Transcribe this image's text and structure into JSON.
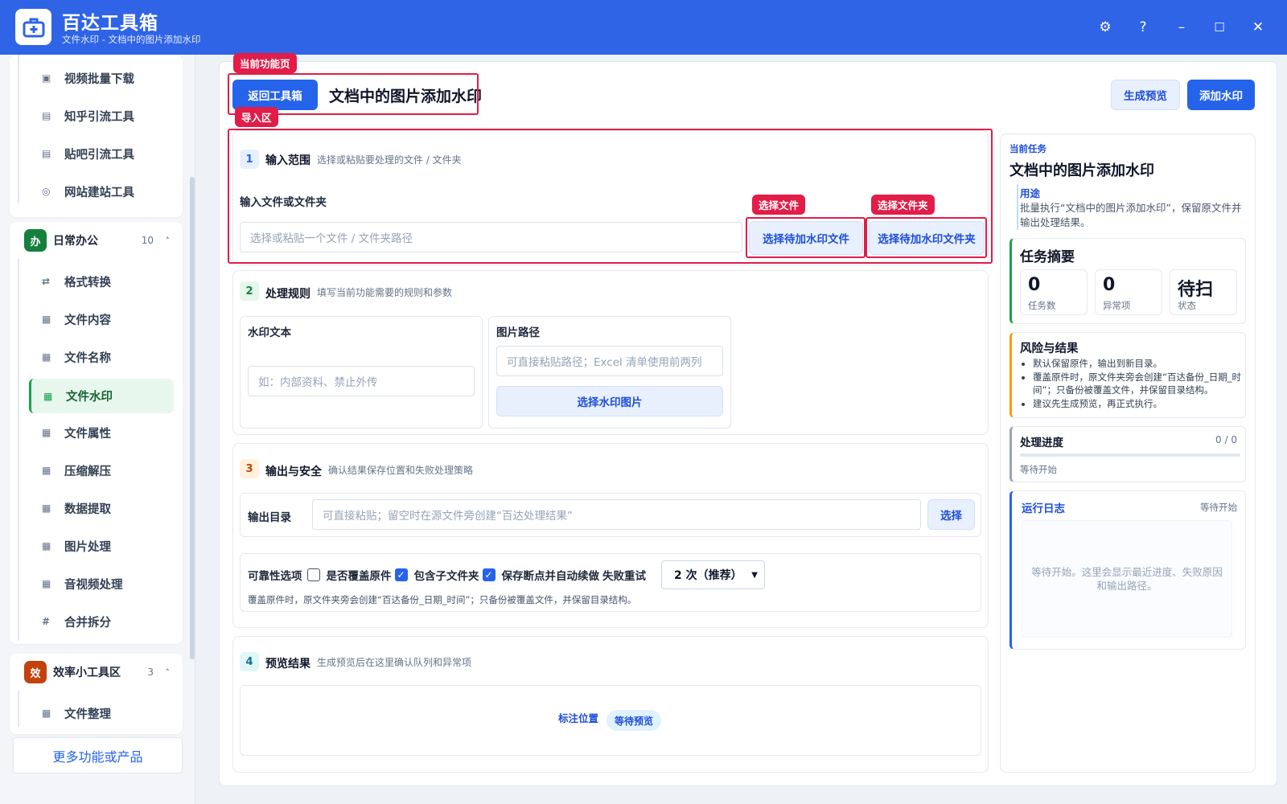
{
  "app": {
    "title": "百达工具箱",
    "subtitle": "文件水印 - 文档中的图片添加水印",
    "logo_icon": "toolbox-icon",
    "controls": {
      "settings": "⚙",
      "help": "?",
      "minimize": "–",
      "maximize": "☐",
      "close": "✕"
    }
  },
  "sidebar": {
    "top_items": [
      {
        "label": "视频批量下载",
        "icon": "▣"
      },
      {
        "label": "知乎引流工具",
        "icon": "▤"
      },
      {
        "label": "贴吧引流工具",
        "icon": "▤"
      },
      {
        "label": "网站建站工具",
        "icon": "◎"
      }
    ],
    "group_daily": {
      "badge": "办",
      "label": "日常办公",
      "count": "10",
      "chevron": "˄"
    },
    "daily_items": [
      {
        "label": "格式转换",
        "icon": "⇄"
      },
      {
        "label": "文件内容",
        "icon": "▦"
      },
      {
        "label": "文件名称",
        "icon": "▦"
      },
      {
        "label": "文件水印",
        "icon": "▦",
        "active": true
      },
      {
        "label": "文件属性",
        "icon": "▦"
      },
      {
        "label": "压缩解压",
        "icon": "▦"
      },
      {
        "label": "数据提取",
        "icon": "▦"
      },
      {
        "label": "图片处理",
        "icon": "▦"
      },
      {
        "label": "音视频处理",
        "icon": "▦"
      },
      {
        "label": "合并拆分",
        "icon": "#"
      }
    ],
    "group_efficiency": {
      "badge": "效",
      "label": "效率小工具区",
      "count": "3",
      "chevron": "˄"
    },
    "efficiency_items": [
      {
        "label": "文件整理",
        "icon": "▦"
      }
    ],
    "more_button": "更多功能或产品"
  },
  "annotations": {
    "current_page": "当前功能页",
    "import_area": "导入区",
    "select_file": "选择文件",
    "select_folder": "选择文件夹"
  },
  "header": {
    "back_button": "返回工具箱",
    "page_title": "文档中的图片添加水印",
    "preview_button": "生成预览",
    "run_button": "添加水印"
  },
  "section1": {
    "num": "1",
    "title": "输入范围",
    "desc": "选择或粘贴要处理的文件 / 文件夹",
    "field_label": "输入文件或文件夹",
    "placeholder": "选择或粘贴一个文件 / 文件夹路径",
    "select_file_btn": "选择待加水印文件",
    "select_folder_btn": "选择待加水印文件夹"
  },
  "section2": {
    "num": "2",
    "title": "处理规则",
    "desc": "填写当前功能需要的规则和参数",
    "watermark_label": "水印文本",
    "watermark_placeholder": "如：内部资料、禁止外传",
    "image_label": "图片路径",
    "image_placeholder": "可直接粘贴路径；Excel 清单使用前两列",
    "image_button": "选择水印图片"
  },
  "section3": {
    "num": "3",
    "title": "输出与安全",
    "desc": "确认结果保存位置和失败处理策略",
    "output_label": "输出目录",
    "output_placeholder": "可直接粘贴；留空时在源文件旁创建“百达处理结果”",
    "output_button": "选择",
    "reliability_label": "可靠性选项",
    "opt_overwrite": "是否覆盖原件",
    "opt_overwrite_checked": false,
    "opt_subfolder": "包含子文件夹",
    "opt_subfolder_checked": true,
    "opt_resume": "保存断点并自动续做",
    "opt_resume_checked": true,
    "retry_label": "失败重试",
    "retry_value": "2 次（推荐）",
    "note": "覆盖原件时，原文件夹旁会创建“百达备份_日期_时间”；只备份被覆盖文件，并保留目录结构。"
  },
  "section4": {
    "num": "4",
    "title": "预览结果",
    "desc": "生成预览后在这里确认队列和异常项",
    "mark_position": "标注位置",
    "status_pill": "等待预览"
  },
  "right_panel": {
    "current_task_label": "当前任务",
    "task_title": "文档中的图片添加水印",
    "purpose_label": "用途",
    "purpose_text": "批量执行“文档中的图片添加水印”，保留原文件并输出处理结果。",
    "summary_title": "任务摘要",
    "stats": [
      {
        "value": "0",
        "label": "任务数"
      },
      {
        "value": "0",
        "label": "异常项"
      },
      {
        "value": "待扫",
        "label": "状态"
      }
    ],
    "risk_title": "风险与结果",
    "risk_items": [
      "默认保留原件，输出到新目录。",
      "覆盖原件时，原文件夹旁会创建“百达备份_日期_时间”；只备份被覆盖文件，并保留目录结构。",
      "建议先生成预览，再正式执行。"
    ],
    "progress_title": "处理进度",
    "progress_count": "0 / 0",
    "progress_fraction": 0,
    "progress_status": "等待开始",
    "log_title": "运行日志",
    "log_status": "等待开始",
    "log_placeholder": "等待开始。这里会显示最近进度、失败原因和输出路径。"
  },
  "colors": {
    "primary": "#2f64e6",
    "accent": "#e11d48",
    "active_green": "#16a34a"
  }
}
